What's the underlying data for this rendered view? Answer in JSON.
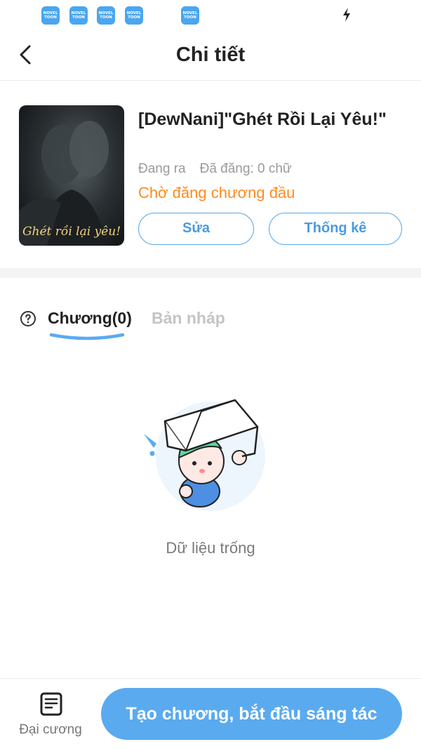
{
  "status_bar": {
    "app_icons": [
      {
        "name": "novel-toon-icon",
        "line1": "NOVEL",
        "line2": "TOON"
      },
      {
        "name": "novel-toon-icon",
        "line1": "NOVEL",
        "line2": "TOON"
      },
      {
        "name": "novel-toon-icon",
        "line1": "NOVEL",
        "line2": "TOON"
      },
      {
        "name": "novel-toon-icon",
        "line1": "NOVEL",
        "line2": "TOON"
      },
      {
        "name": "novel-toon-icon",
        "line1": "NOVEL",
        "line2": "TOON"
      }
    ],
    "right_icon": "lightning-icon"
  },
  "header": {
    "title": "Chi tiết",
    "back_icon": "chevron-left-icon"
  },
  "book": {
    "cover_text": "Ghét rồi lại yêu!",
    "title": "[DewNani]\"Ghét Rồi Lại Yêu!\"",
    "status": "Đang ra",
    "published": "Đã đăng: 0 chữ",
    "notice": "Chờ đăng chương đầu",
    "edit_label": "Sửa",
    "stats_label": "Thống kê"
  },
  "tabs": {
    "help_icon": "question-circle-icon",
    "items": [
      {
        "label": "Chương(0)",
        "active": true
      },
      {
        "label": "Bản nháp",
        "active": false
      }
    ]
  },
  "empty_state": {
    "illustration": "box-character-illustration",
    "text": "Dữ liệu trống"
  },
  "bottom_bar": {
    "outline_label": "Đại cương",
    "outline_icon": "document-list-icon",
    "create_label": "Tạo chương, bắt đầu sáng tác"
  },
  "colors": {
    "accent": "#5aaaf0",
    "notice": "#ff8a1f",
    "muted": "#9a9a9a",
    "inactive_tab": "#c4c4c4"
  }
}
